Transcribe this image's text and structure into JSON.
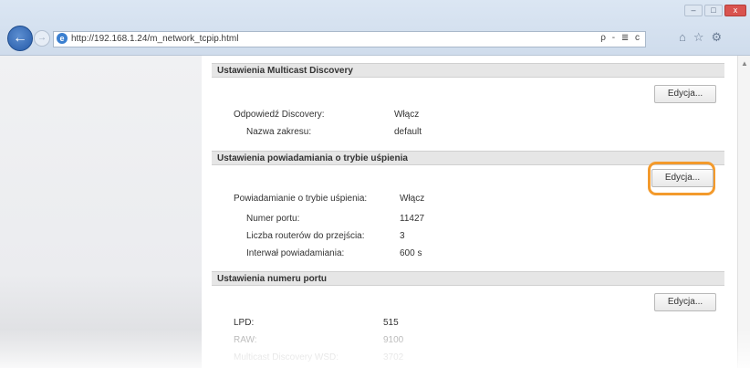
{
  "browser": {
    "url": "http://192.168.1.24/m_network_tcpip.html",
    "address_tools": "ρ - ≣ c",
    "window_buttons": [
      "–",
      "□",
      "x"
    ]
  },
  "sections": [
    {
      "title": "Ustawienia Multicast Discovery",
      "edit_label": "Edycja...",
      "rows": [
        {
          "label": "Odpowiedź Discovery:",
          "value": "Włącz"
        },
        {
          "label": "Nazwa zakresu:",
          "value": "default"
        }
      ]
    },
    {
      "title": "Ustawienia powiadamiania o trybie uśpienia",
      "edit_label": "Edycja...",
      "rows": [
        {
          "label": "Powiadamianie o trybie uśpienia:",
          "value": "Włącz"
        },
        {
          "label": "Numer portu:",
          "value": "11427"
        },
        {
          "label": "Liczba routerów do przejścia:",
          "value": "3"
        },
        {
          "label": "Interwał powiadamiania:",
          "value": "600 s"
        }
      ]
    },
    {
      "title": "Ustawienia numeru portu",
      "edit_label": "Edycja...",
      "rows": [
        {
          "label": "LPD:",
          "value": "515"
        },
        {
          "label": "RAW:",
          "value": "9100"
        },
        {
          "label": "Multicast Discovery WSD:",
          "value": "3702"
        }
      ]
    }
  ],
  "colors": {
    "highlight": "#f39a2c",
    "section_header_bg": "#e6e6e6"
  }
}
